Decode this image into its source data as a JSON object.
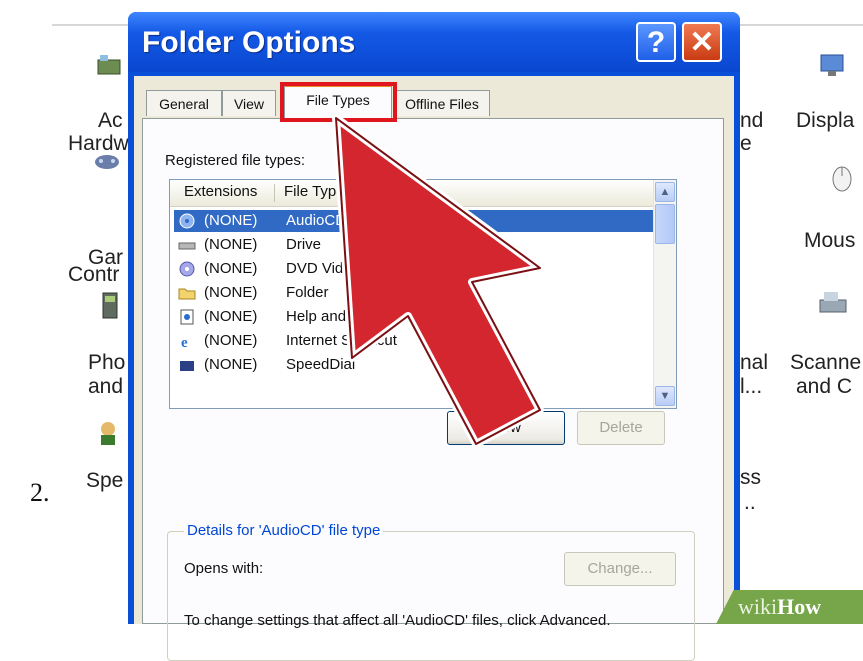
{
  "step_number": "2.",
  "control_panel": {
    "items": [
      {
        "label": "Ac",
        "icon": "add-hardware-icon"
      },
      {
        "label": "Hardw",
        "icon": ""
      },
      {
        "label": "Gar",
        "icon": "game-controller-icon"
      },
      {
        "label": "Contr",
        "icon": ""
      },
      {
        "label": "Pho",
        "icon": "phone-icon"
      },
      {
        "label": "and",
        "icon": ""
      },
      {
        "label": "Spe",
        "icon": "speech-icon"
      },
      {
        "label": "nd",
        "icon": ""
      },
      {
        "label": "e",
        "icon": ""
      },
      {
        "label": "nal",
        "icon": ""
      },
      {
        "label": "l...",
        "icon": ""
      },
      {
        "label": "ss",
        "icon": ""
      },
      {
        "label": "..",
        "icon": ""
      },
      {
        "label": "Displa",
        "icon": "display-icon"
      },
      {
        "label": "Mous",
        "icon": "mouse-icon"
      },
      {
        "label": "Scanne",
        "icon": "scanner-icon"
      },
      {
        "label": "and C",
        "icon": ""
      }
    ]
  },
  "dialog": {
    "title": "Folder Options",
    "help_button": "?",
    "close_button": "✕",
    "tabs": [
      {
        "label": "General",
        "active": false
      },
      {
        "label": "View",
        "active": false
      },
      {
        "label": "File Types",
        "active": true
      },
      {
        "label": "Offline Files",
        "active": false
      }
    ],
    "registered_label": "Registered file types:",
    "columns": [
      "Extensions",
      "File Types"
    ],
    "rows": [
      {
        "ext": "(NONE)",
        "type": "AudioCD",
        "icon": "audio-cd-icon",
        "selected": true
      },
      {
        "ext": "(NONE)",
        "type": "Drive",
        "icon": "drive-icon",
        "selected": false
      },
      {
        "ext": "(NONE)",
        "type": "DVD Video",
        "icon": "dvd-icon",
        "selected": false
      },
      {
        "ext": "(NONE)",
        "type": "Folder",
        "icon": "folder-icon",
        "selected": false
      },
      {
        "ext": "(NONE)",
        "type": "Help and Support protocol",
        "icon": "help-file-icon",
        "selected": false
      },
      {
        "ext": "(NONE)",
        "type": "Internet Shortcut",
        "icon": "internet-explorer-icon",
        "selected": false
      },
      {
        "ext": "(NONE)",
        "type": "SpeedDial",
        "icon": "speed-dial-icon",
        "selected": false
      }
    ],
    "new_button": "New",
    "delete_button": "Delete",
    "details_title": "Details for 'AudioCD' file type",
    "opens_with_label": "Opens with:",
    "change_button": "Change...",
    "advanced_note": "To change settings that affect all 'AudioCD' files, click Advanced."
  },
  "watermark": {
    "wiki": "wiki",
    "how": "How"
  },
  "colors": {
    "title_bar": "#0a47cf",
    "highlight_box": "#e0161e",
    "arrow_fill": "#d3262e",
    "selection": "#316ac5",
    "watermark_bg": "#76a54a"
  }
}
